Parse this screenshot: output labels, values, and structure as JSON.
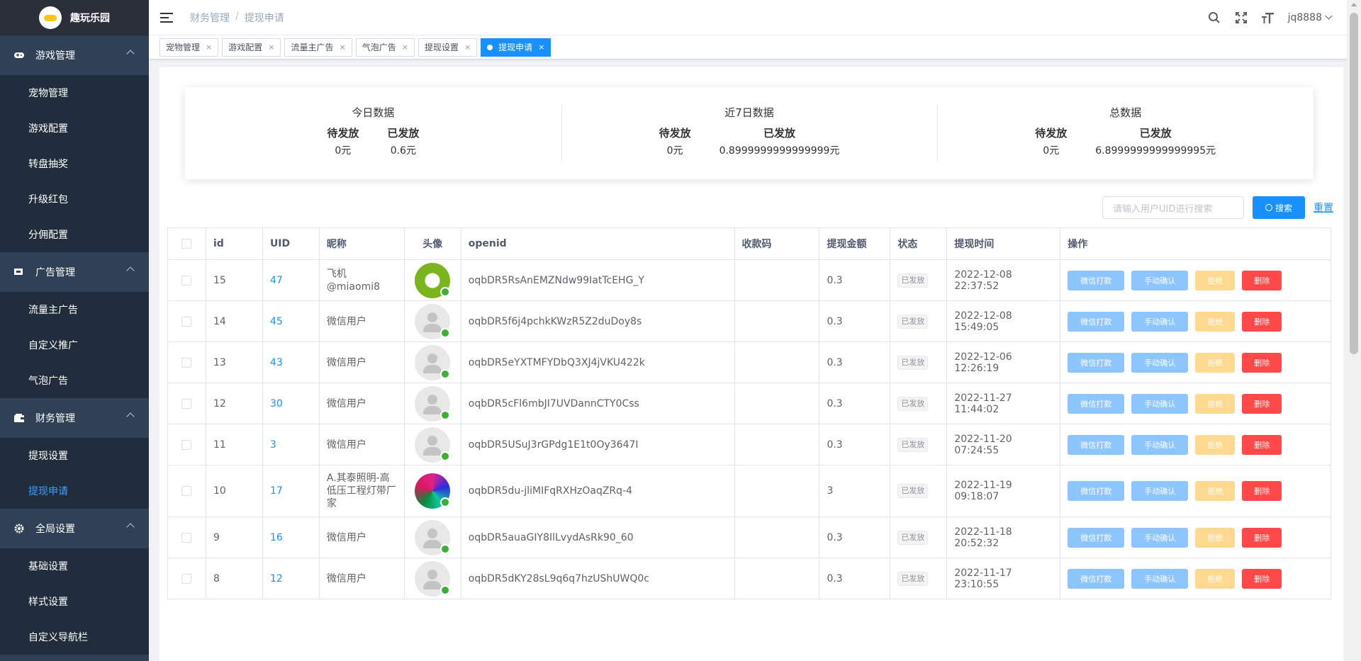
{
  "app": {
    "name": "趣玩乐园"
  },
  "sidebar": {
    "groups": [
      {
        "label": "游戏管理",
        "icon": "gamepad-icon",
        "items": [
          "宠物管理",
          "游戏配置",
          "转盘抽奖",
          "升级红包",
          "分佣配置"
        ]
      },
      {
        "label": "广告管理",
        "icon": "ad-icon",
        "items": [
          "流量主广告",
          "自定义推广",
          "气泡广告"
        ]
      },
      {
        "label": "财务管理",
        "icon": "wallet-icon",
        "items": [
          "提现设置",
          "提现申请"
        ]
      },
      {
        "label": "全局设置",
        "icon": "gear-icon",
        "items": [
          "基础设置",
          "样式设置",
          "自定义导航栏"
        ]
      }
    ],
    "active_item": "提现申请"
  },
  "navbar": {
    "breadcrumb": [
      "财务管理",
      "提现申请"
    ],
    "breadcrumb_sep": "/",
    "user": "jq8888"
  },
  "tags": [
    "宠物管理",
    "游戏配置",
    "流量主广告",
    "气泡广告",
    "提现设置",
    "提现申请"
  ],
  "tag_close": "×",
  "stats": [
    {
      "title": "今日数据",
      "pending_label": "待发放",
      "pending": "0元",
      "sent_label": "已发放",
      "sent": "0.6元"
    },
    {
      "title": "近7日数据",
      "pending_label": "待发放",
      "pending": "0元",
      "sent_label": "已发放",
      "sent": "0.8999999999999999元"
    },
    {
      "title": "总数据",
      "pending_label": "待发放",
      "pending": "0元",
      "sent_label": "已发放",
      "sent": "6.8999999999999995元"
    }
  ],
  "search": {
    "placeholder": "请输入用户UID进行搜索",
    "button": "搜索",
    "reset": "重置"
  },
  "table": {
    "headers": [
      "id",
      "UID",
      "昵称",
      "头像",
      "openid",
      "收款码",
      "提现金额",
      "状态",
      "提现时间",
      "操作"
    ],
    "actions": {
      "pay": "微信打款",
      "manual": "手动确认",
      "reject": "拒绝",
      "delete": "删除"
    },
    "rows": [
      {
        "id": "15",
        "uid": "47",
        "nickname": "飞机@miaomi8",
        "avatar": "green",
        "openid": "oqbDR5RsAnEMZNdw99IatTcEHG_Y",
        "code": "",
        "amount": "0.3",
        "status": "已发放",
        "time": "2022-12-08 22:37:52"
      },
      {
        "id": "14",
        "uid": "45",
        "nickname": "微信用户",
        "avatar": "default",
        "openid": "oqbDR5f6j4pchkKWzR5Z2duDoy8s",
        "code": "",
        "amount": "0.3",
        "status": "已发放",
        "time": "2022-12-08 15:49:05"
      },
      {
        "id": "13",
        "uid": "43",
        "nickname": "微信用户",
        "avatar": "default",
        "openid": "oqbDR5eYXTMFYDbQ3XJ4jVKU422k",
        "code": "",
        "amount": "0.3",
        "status": "已发放",
        "time": "2022-12-06 12:26:19"
      },
      {
        "id": "12",
        "uid": "30",
        "nickname": "微信用户",
        "avatar": "default",
        "openid": "oqbDR5cFl6mbJI7UVDannCTY0Css",
        "code": "",
        "amount": "0.3",
        "status": "已发放",
        "time": "2022-11-27 11:44:02"
      },
      {
        "id": "11",
        "uid": "3",
        "nickname": "微信用户",
        "avatar": "default",
        "openid": "oqbDR5USuJ3rGPdg1E1t0Oy3647I",
        "code": "",
        "amount": "0.3",
        "status": "已发放",
        "time": "2022-11-20 07:24:55"
      },
      {
        "id": "10",
        "uid": "17",
        "nickname": "A.其泰照明-高低压工程灯带厂家",
        "avatar": "color",
        "openid": "oqbDR5du-jliMIFqRXHzOaqZRq-4",
        "code": "",
        "amount": "3",
        "status": "已发放",
        "time": "2022-11-19 09:18:07"
      },
      {
        "id": "9",
        "uid": "16",
        "nickname": "微信用户",
        "avatar": "default",
        "openid": "oqbDR5auaGIY8IlLvydAsRk90_60",
        "code": "",
        "amount": "0.3",
        "status": "已发放",
        "time": "2022-11-18 20:52:32"
      },
      {
        "id": "8",
        "uid": "12",
        "nickname": "微信用户",
        "avatar": "default",
        "openid": "oqbDR5dKY28sL9q6q7hzUShUWQ0c",
        "code": "",
        "amount": "0.3",
        "status": "已发放",
        "time": "2022-11-17 23:10:55"
      }
    ]
  },
  "colors": {
    "sidebar_bg": "#304156",
    "accent": "#1890ff",
    "danger": "#ff4949",
    "warning": "#ffd98f",
    "primary_light": "#8cc5ff"
  }
}
